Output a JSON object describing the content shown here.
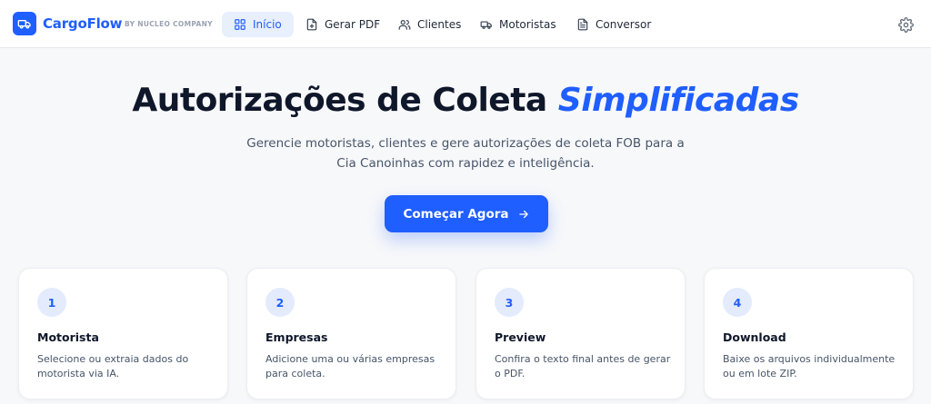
{
  "header": {
    "brand": "CargoFlow",
    "brand_sub": "BY NUCLEO COMPANY",
    "logo_icon": "truck-icon",
    "nav": [
      {
        "label": "Início",
        "icon": "grid-icon",
        "active": true
      },
      {
        "label": "Gerar PDF",
        "icon": "file-plus-icon",
        "active": false
      },
      {
        "label": "Clientes",
        "icon": "users-icon",
        "active": false
      },
      {
        "label": "Motoristas",
        "icon": "truck-icon",
        "active": false
      },
      {
        "label": "Conversor",
        "icon": "file-text-icon",
        "active": false
      }
    ],
    "settings_icon": "gear-icon"
  },
  "hero": {
    "title_main": "Autorizações de Coleta ",
    "title_accent": "Simplificadas",
    "subtitle": "Gerencie motoristas, clientes e gere autorizações de coleta FOB para a Cia Canoinhas com rapidez e inteligência.",
    "cta_label": "Começar Agora",
    "cta_icon": "arrow-right-icon"
  },
  "steps": [
    {
      "number": "1",
      "title": "Motorista",
      "description": "Selecione ou extraia dados do motorista via IA."
    },
    {
      "number": "2",
      "title": "Empresas",
      "description": "Adicione uma ou várias empresas para coleta."
    },
    {
      "number": "3",
      "title": "Preview",
      "description": "Confira o texto final antes de gerar o PDF."
    },
    {
      "number": "4",
      "title": "Download",
      "description": "Baixe os arquivos individualmente ou em lote ZIP."
    }
  ],
  "colors": {
    "accent": "#1f5eff",
    "accent_soft": "#e8effd",
    "text": "#0f172a",
    "muted": "#475569",
    "background": "#f7f8fa"
  }
}
